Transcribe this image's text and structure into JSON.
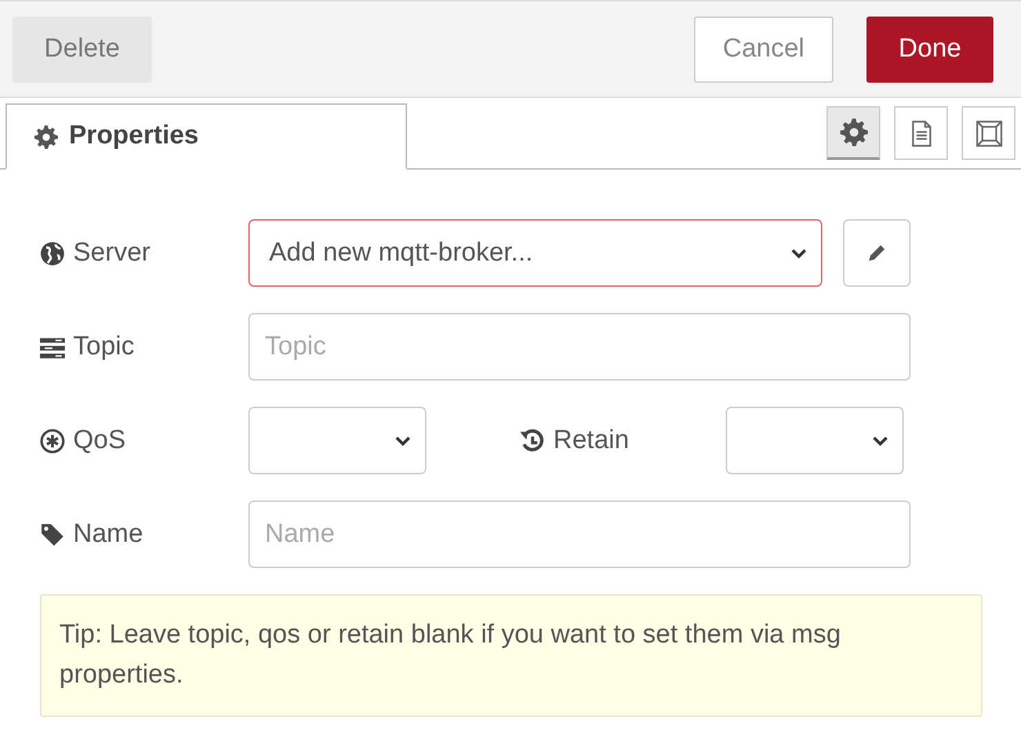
{
  "toolbar": {
    "left_buttons": [
      {
        "label": "Delete",
        "kind": "secondary"
      }
    ],
    "right_buttons": [
      {
        "label": "Cancel",
        "kind": "default"
      },
      {
        "label": "Done",
        "kind": "primary"
      }
    ]
  },
  "tabs": [
    {
      "label": "Properties",
      "selected": true
    }
  ],
  "side_tabs": [
    {
      "kind": "settings",
      "selected": true
    },
    {
      "kind": "description",
      "selected": false
    },
    {
      "kind": "appearance",
      "selected": false
    }
  ],
  "form": {
    "rows": [
      {
        "kind": "server",
        "label": "Server",
        "fields": [
          {
            "kind": "select",
            "value": "Add new mqtt-broker...",
            "invalid": true,
            "edit_button": true
          }
        ]
      },
      {
        "kind": "topic",
        "label": "Topic",
        "fields": [
          {
            "kind": "input",
            "placeholder": "Topic"
          }
        ]
      },
      {
        "kind": "qos",
        "label": "QoS",
        "fields": [
          {
            "kind": "select"
          }
        ],
        "second": {
          "kind": "retain",
          "label": "Retain",
          "fields": [
            {
              "kind": "select"
            }
          ]
        }
      },
      {
        "kind": "name",
        "label": "Name",
        "fields": [
          {
            "kind": "input",
            "placeholder": "Name"
          }
        ]
      }
    ],
    "tip": "Tip: Leave topic, qos or retain blank if you want to set them via msg properties."
  }
}
